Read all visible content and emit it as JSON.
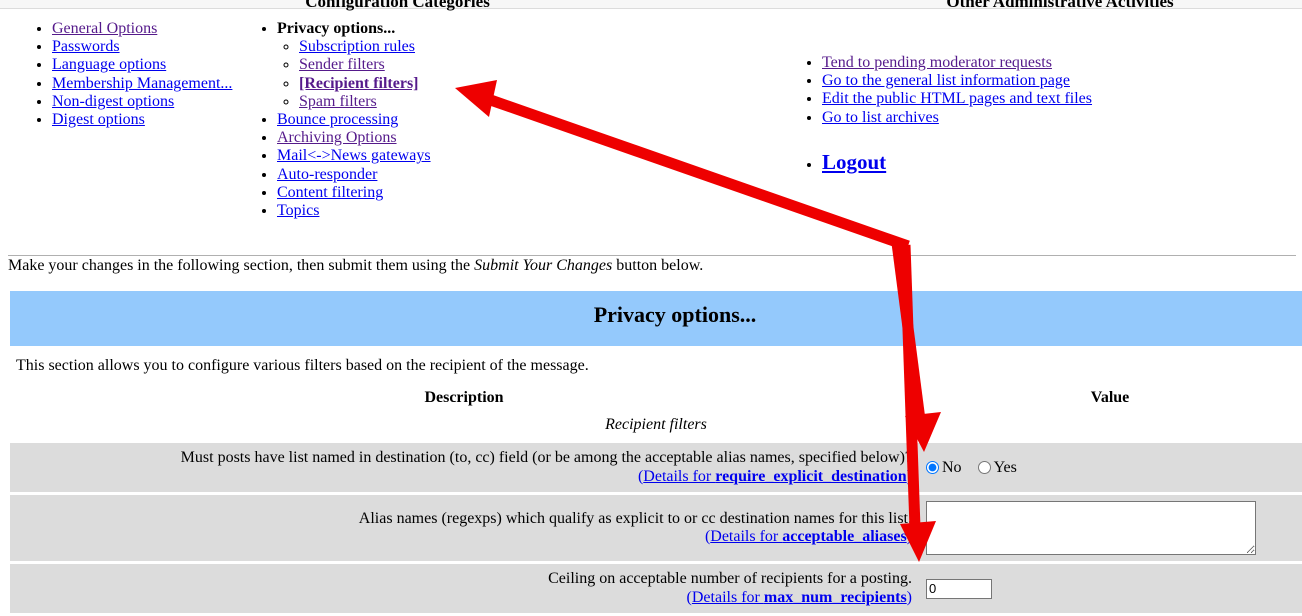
{
  "headings": {
    "configuration_categories": "Configuration Categories",
    "other_admin": "Other Administrative Activities"
  },
  "categories_left": [
    {
      "label": "General Options",
      "state": "visited"
    },
    {
      "label": "Passwords",
      "state": "link"
    },
    {
      "label": "Language options",
      "state": "link"
    },
    {
      "label": "Membership Management...",
      "state": "link"
    },
    {
      "label": "Non-digest options",
      "state": "link"
    },
    {
      "label": "Digest options",
      "state": "link"
    }
  ],
  "categories_mid": {
    "privacy_label": "Privacy options...",
    "sub_items": [
      {
        "label": "Subscription rules",
        "state": "link"
      },
      {
        "label": "Sender filters",
        "state": "visited"
      },
      {
        "label": "[Recipient filters]",
        "state": "current"
      },
      {
        "label": "Spam filters",
        "state": "visited"
      }
    ],
    "rest": [
      {
        "label": "Bounce processing",
        "state": "link"
      },
      {
        "label": "Archiving Options",
        "state": "visited"
      },
      {
        "label": "Mail<->News gateways",
        "state": "link"
      },
      {
        "label": "Auto-responder",
        "state": "link"
      },
      {
        "label": "Content filtering",
        "state": "link"
      },
      {
        "label": "Topics",
        "state": "link"
      }
    ]
  },
  "admin_links": [
    {
      "label": "Tend to pending moderator requests",
      "state": "visited"
    },
    {
      "label": "Go to the general list information page",
      "state": "link"
    },
    {
      "label": "Edit the public HTML pages and text files",
      "state": "link"
    },
    {
      "label": "Go to list archives",
      "state": "link"
    }
  ],
  "logout_label": "Logout",
  "intro": {
    "before": "Make your changes in the following section, then submit them using the ",
    "emphasis": "Submit Your Changes",
    "after": " button below."
  },
  "section": {
    "banner_title": "Privacy options...",
    "description": "This section allows you to configure various filters based on the recipient of the message.",
    "col_description": "Description",
    "col_value": "Value",
    "subheading": "Recipient filters"
  },
  "options": [
    {
      "description": "Must posts have list named in destination (to, cc) field (or be among the acceptable alias names, specified below)?",
      "details_prefix": "(Details for ",
      "details_name": "require_explicit_destination",
      "details_suffix": ")",
      "control": "radio",
      "radio_options": [
        {
          "label": "No",
          "checked": true
        },
        {
          "label": "Yes",
          "checked": false
        }
      ]
    },
    {
      "description": "Alias names (regexps) which qualify as explicit to or cc destination names for this list.",
      "details_prefix": "(Details for ",
      "details_name": "acceptable_aliases",
      "details_suffix": ")",
      "control": "textarea",
      "value": ""
    },
    {
      "description": "Ceiling on acceptable number of recipients for a posting.",
      "details_prefix": "(Details for ",
      "details_name": "max_num_recipients",
      "details_suffix": ")",
      "control": "text",
      "value": "0"
    }
  ],
  "colors": {
    "banner_blue": "#94c9fc",
    "row_gray": "#dcdcdc",
    "link_blue": "#0000ee",
    "link_visited": "#551a8b",
    "annotation_red": "#ee0000"
  }
}
